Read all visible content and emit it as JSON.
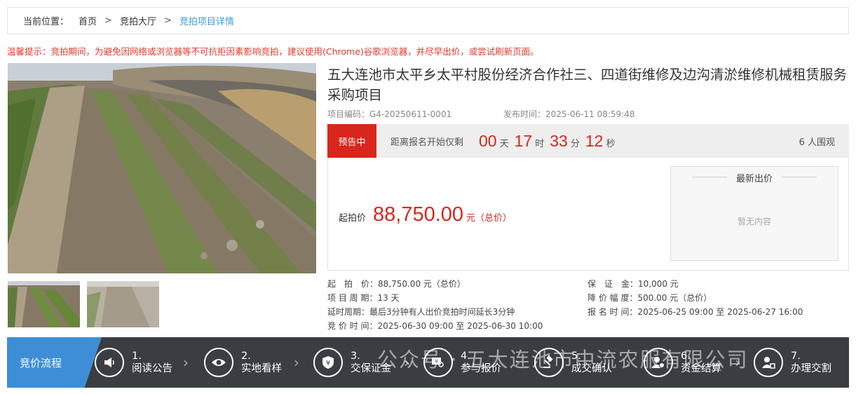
{
  "breadcrumb": {
    "label": "当前位置：",
    "home": "首页",
    "sep1": ">",
    "hall": "竞拍大厅",
    "sep2": ">",
    "current": "竞拍项目详情"
  },
  "notice": "温馨提示：竞拍期间，为避免因网络或浏览器等不可抗拒因素影响竞拍，建议使用(Chrome)谷歌浏览器，并尽早出价，或尝试刷新页面。",
  "project": {
    "title": "五大连池市太平乡太平村股份经济合作社三、四道街维修及边沟清淤维修机械租赁服务采购项目",
    "code": "项目编码：G4-20250611-0001",
    "published": "发布时间：2025-06-11 08:59:48"
  },
  "status": {
    "badge": "预告中",
    "countdown_label": "距离报名开始仅剩",
    "days": "00",
    "days_unit": "天",
    "hours": "17",
    "hours_unit": "时",
    "minutes": "33",
    "minutes_unit": "分",
    "seconds": "12",
    "seconds_unit": "秒",
    "watchers": "6 人围观"
  },
  "price": {
    "label": "起拍价",
    "value": "88,750.00",
    "unit": "元（总价）"
  },
  "latest_bid": {
    "title": "最新出价",
    "empty": "暂无内容"
  },
  "details": {
    "start_price": "起　拍　价：88,750.00 元（总价）",
    "deposit": "保　证　金：10,000 元",
    "cycle": "项 目 周 期：13 天",
    "decrement": "降 价 幅 度：500.00 元（总价）",
    "delay": "延时周期：最后3分钟有人出价竞拍时间延长3分钟",
    "signup_time": "报 名 时 间：2025-06-25 09:00 至 2025-06-27 16:00",
    "bid_time": "竞 价 时 间：2025-06-30 09:00 至 2025-06-30 10:00"
  },
  "process": {
    "label": "竞价流程",
    "steps": [
      {
        "num": "1.",
        "label": "阅读公告",
        "icon": "megaphone-icon"
      },
      {
        "num": "2.",
        "label": "实地看样",
        "icon": "eye-icon"
      },
      {
        "num": "3.",
        "label": "交保证金",
        "icon": "shield-yuan-icon"
      },
      {
        "num": "4.",
        "label": "参与报价",
        "icon": "price-search-icon"
      },
      {
        "num": "5.",
        "label": "成交确认",
        "icon": "gavel-icon"
      },
      {
        "num": "6.",
        "label": "资金结算",
        "icon": "user-money-icon"
      },
      {
        "num": "7.",
        "label": "办理交割",
        "icon": "user-handover-icon"
      }
    ]
  },
  "watermark": "公众号 · 五大连池市中流农服有限公司",
  "colors": {
    "accent_red": "#d9261c",
    "link_blue": "#3d9cd6",
    "process_bar": "#3a3d42",
    "process_tab": "#3d8ed6"
  }
}
